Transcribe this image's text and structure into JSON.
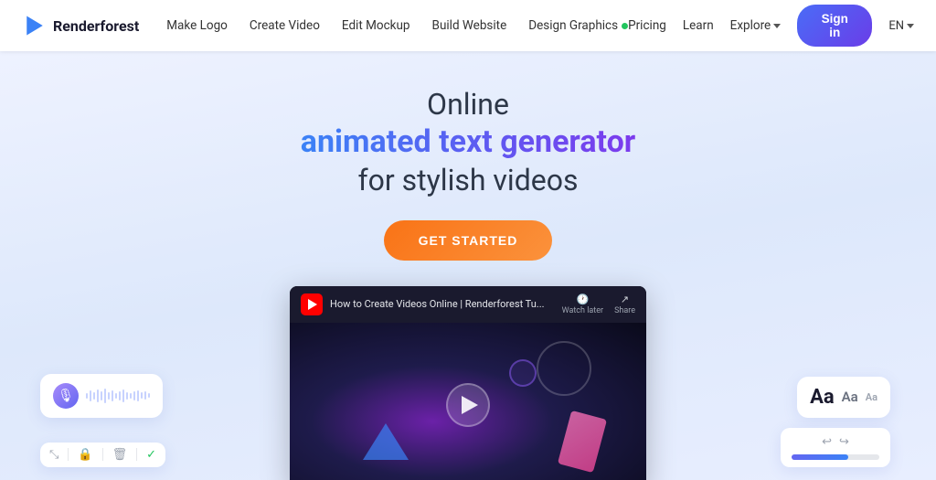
{
  "brand": {
    "name": "Renderforest",
    "logo_alt": "Renderforest logo"
  },
  "navbar": {
    "links": [
      {
        "id": "make-logo",
        "label": "Make Logo",
        "badge": false
      },
      {
        "id": "create-video",
        "label": "Create Video",
        "badge": false
      },
      {
        "id": "edit-mockup",
        "label": "Edit Mockup",
        "badge": false
      },
      {
        "id": "build-website",
        "label": "Build Website",
        "badge": false
      },
      {
        "id": "design-graphics",
        "label": "Design Graphics",
        "badge": true
      }
    ],
    "right": {
      "pricing": "Pricing",
      "learn": "Learn",
      "explore": "Explore",
      "signin": "Sign in",
      "lang": "EN"
    }
  },
  "hero": {
    "line1": "Online",
    "line2": "animated text generator",
    "line3": "for stylish videos",
    "cta_label": "GET STARTED"
  },
  "video": {
    "title": "How to Create Videos Online | Renderforest Tu...",
    "watch_later": "Watch later",
    "share": "Share"
  },
  "widgets": {
    "font_sizes": [
      "Aa",
      "Aa",
      "Aa"
    ],
    "toolbar_icons": [
      "⤡",
      "🔒",
      "🗑",
      "✓"
    ]
  }
}
